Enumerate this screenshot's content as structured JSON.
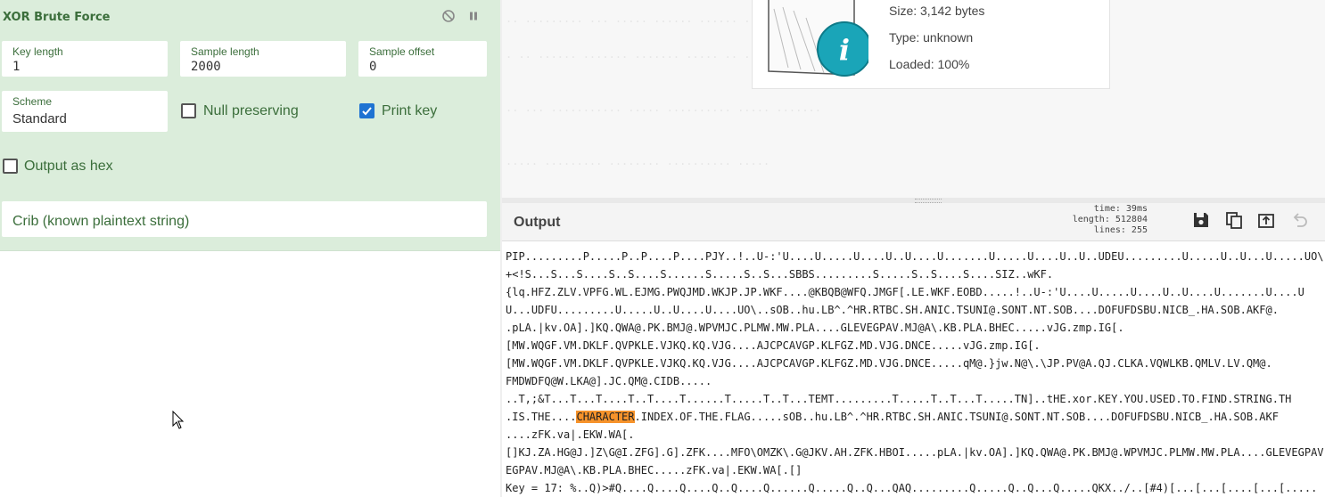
{
  "operation": {
    "title": "XOR Brute Force",
    "key_length": {
      "label": "Key length",
      "value": "1"
    },
    "sample_length": {
      "label": "Sample length",
      "value": "2000"
    },
    "sample_offset": {
      "label": "Sample offset",
      "value": "0"
    },
    "scheme": {
      "label": "Scheme",
      "value": "Standard"
    },
    "null_preserving": {
      "label": "Null preserving",
      "checked": false
    },
    "print_key": {
      "label": "Print key",
      "checked": true
    },
    "output_as_hex": {
      "label": "Output as hex",
      "checked": false
    },
    "crib": {
      "placeholder": "Crib (known plaintext string)"
    }
  },
  "file_info": {
    "size": "Size: 3,142 bytes",
    "type": "Type: unknown",
    "loaded": "Loaded: 100%"
  },
  "output": {
    "title": "Output",
    "time": "time:  39ms",
    "length": "length: 512804",
    "lines": "lines:    255",
    "lines_text": [
      "PIP.........P.....P..P....P....PJY..!..U-:'U....U.....U....U..U....U.......U.....U....U..U..UDEU.........U.....U..U...U.....UO\\..'.",
      "+<!S...S...S....S..S....S......S.....S..S...SBBS.........S.....S..S....S....SIZ..wKF.",
      "{lq.HFZ.ZLV.VPFG.WL.EJMG.PWQJMD.WKJP.JP.WKF....@KBQB@WFQ.JMGF[.LE.WKF.EOBD.....!..U-:'U....U.....U....U..U....U.......U....U",
      "U...UDFU.........U.....U..U....U....UO\\..sOB..hu.LB^.^HR.RTBC.SH.ANIC.TSUNI@.SONT.NT.SOB....DOFUFDSBU.NICB_.HA.SOB.AKF@.",
      ".pLA.|kv.OA].]KQ.QWA@.PK.BMJ@.WPVMJC.PLMW.MW.PLA....GLEVEGPAV.MJ@A\\.KB.PLA.BHEC.....vJG.zmp.IG[.",
      "[MW.WQGF.VM.DKLF.QVPKLE.VJKQ.KQ.VJG....AJCPCAVGP.KLFGZ.MD.VJG.DNCE.....vJG.zmp.IG[.",
      "[MW.WQGF.VM.DKLF.QVPKLE.VJKQ.KQ.VJG....AJCPCAVGP.KLFGZ.MD.VJG.DNCE.....qM@.}jw.N@\\.\\JP.PV@A.QJ.CLKA.VQWLKB.QMLV.LV.QM@.",
      "FMDWDFQ@W.LKA@].JC.QM@.CIDB.....",
      "..T,;&T...T...T....T..T....T......T.....T..T...TEMT.........T.....T..T...T.....TN]..tHE.xor.KEY.YOU.USED.TO.FIND.STRING.TH",
      ".IS.THE....",
      ".INDEX.OF.THE.FLAG.....sOB..hu.LB^.^HR.RTBC.SH.ANIC.TSUNI@.SONT.NT.SOB....DOFUFDSBU.NICB_.HA.SOB.AKF",
      "....zFK.va|.EKW.WA[.",
      "[]KJ.ZA.HG@J.]Z\\G@I.ZFG].G].ZFK....MFO\\OMZK\\.G@JKV.AH.ZFK.HBOI.....pLA.|kv.OA].]KQ.QWA@.PK.BMJ@.WPVMJC.PLMW.MW.PLA....GLEVEGPAV",
      "EGPAV.MJ@A\\.KB.PLA.BHEC.....zFK.va|.EKW.WA[.[]",
      "Key = 17: %..Q)>#Q....Q....Q....Q..Q....Q......Q.....Q..Q...QAQ.........Q.....Q..Q...Q.....QKX../..[#4)[...[...[....[...[....."
    ],
    "highlight": "CHARACTER"
  }
}
